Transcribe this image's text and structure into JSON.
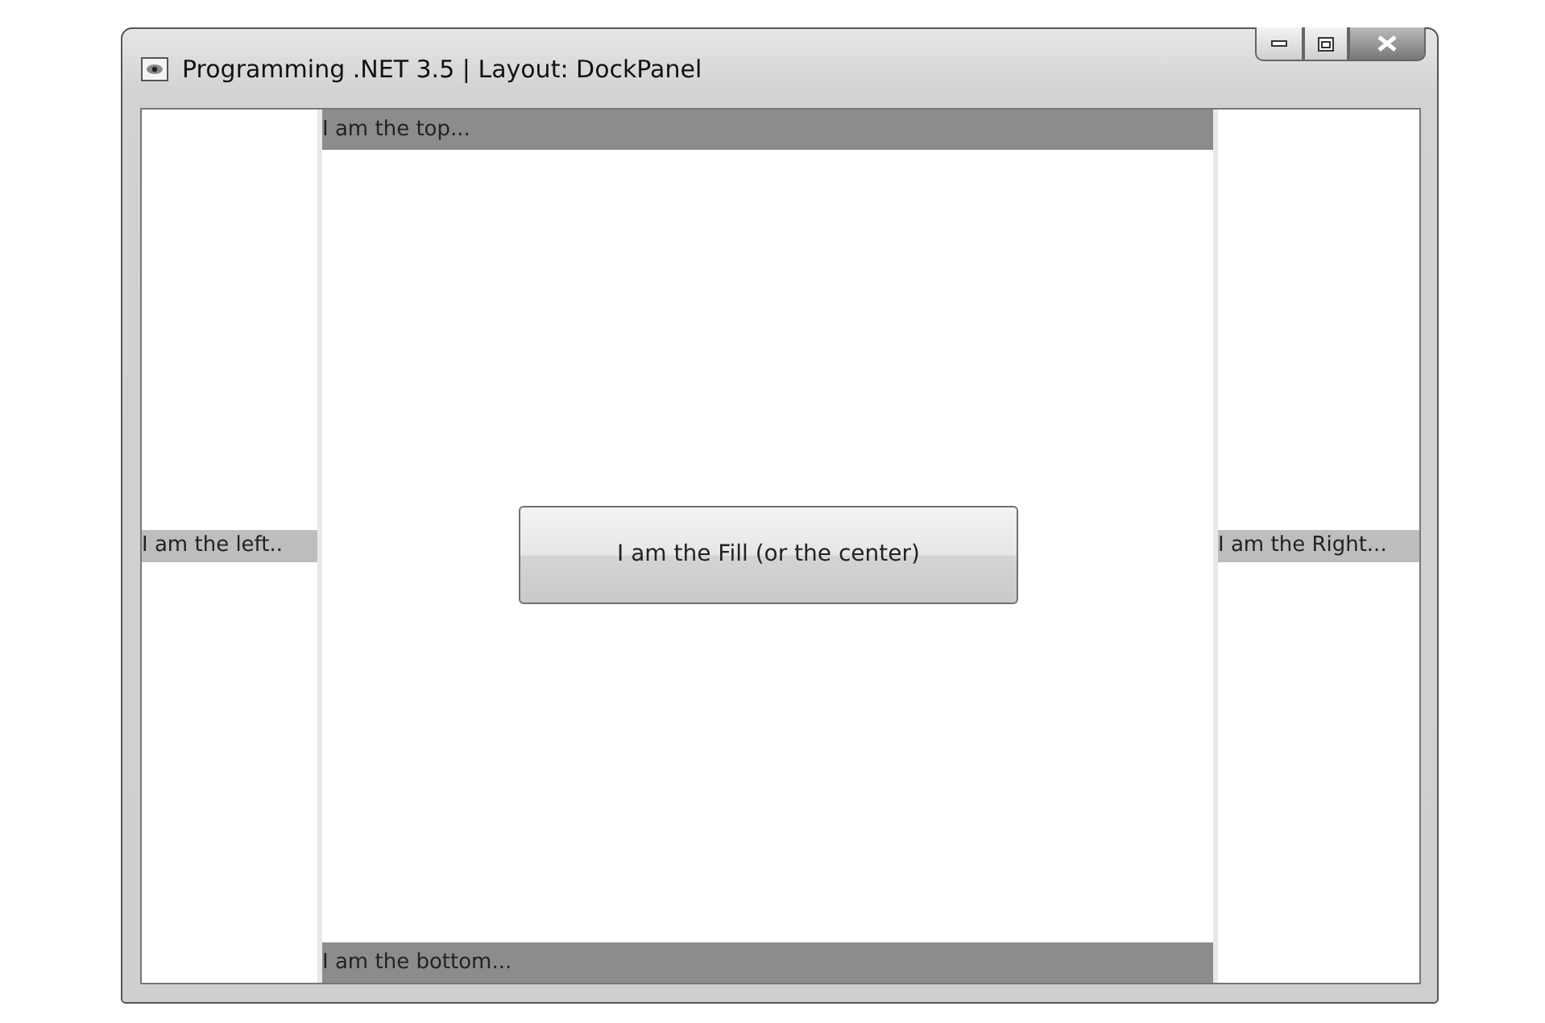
{
  "window": {
    "title": "Programming .NET 3.5 | Layout: DockPanel"
  },
  "dock": {
    "top": "I am the top...",
    "left": "I am the left..",
    "right": "I am the Right...",
    "bottom": "I am the bottom...",
    "fill_button": "I am the Fill (or the center)"
  }
}
